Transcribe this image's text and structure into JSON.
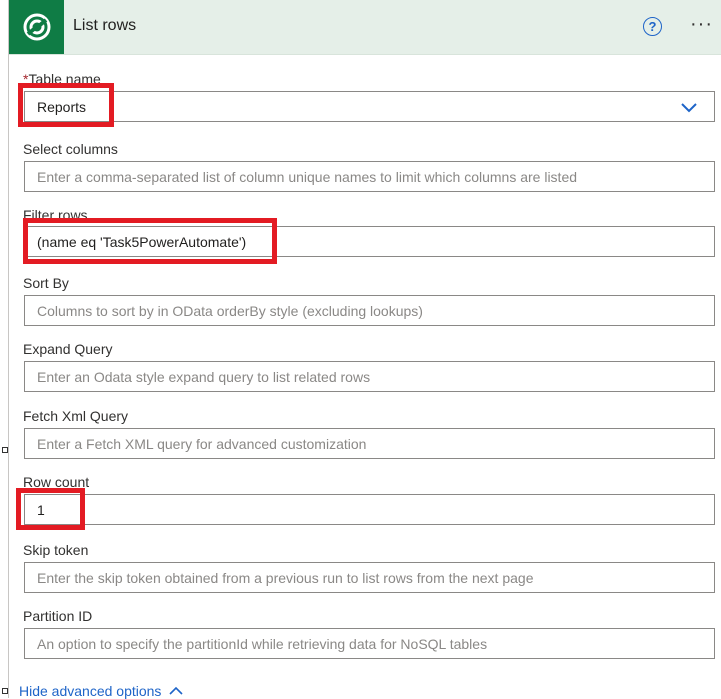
{
  "header": {
    "title": "List rows",
    "help_label": "?",
    "more_label": "···"
  },
  "fields": {
    "table_name": {
      "label": "Table name",
      "required_mark": "*",
      "value": "Reports"
    },
    "select_columns": {
      "label": "Select columns",
      "placeholder": "Enter a comma-separated list of column unique names to limit which columns are listed"
    },
    "filter_rows": {
      "label": "Filter rows",
      "value": "(name eq 'Task5PowerAutomate')"
    },
    "sort_by": {
      "label": "Sort By",
      "placeholder": "Columns to sort by in OData orderBy style (excluding lookups)"
    },
    "expand_query": {
      "label": "Expand Query",
      "placeholder": "Enter an Odata style expand query to list related rows"
    },
    "fetch_xml": {
      "label": "Fetch Xml Query",
      "placeholder": "Enter a Fetch XML query for advanced customization"
    },
    "row_count": {
      "label": "Row count",
      "value": "1"
    },
    "skip_token": {
      "label": "Skip token",
      "placeholder": "Enter the skip token obtained from a previous run to list rows from the next page"
    },
    "partition_id": {
      "label": "Partition ID",
      "placeholder": "An option to specify the partitionId while retrieving data for NoSQL tables"
    }
  },
  "footer": {
    "toggle_label": "Hide advanced options"
  },
  "colors": {
    "header_bg": "#e5efe8",
    "brand": "#0f7c45",
    "accent": "#1e64c8",
    "highlight": "#e31b23"
  },
  "icons": [
    "dataverse-logo-icon",
    "help-icon",
    "more-icon",
    "chevron-down-icon",
    "chevron-up-icon"
  ]
}
